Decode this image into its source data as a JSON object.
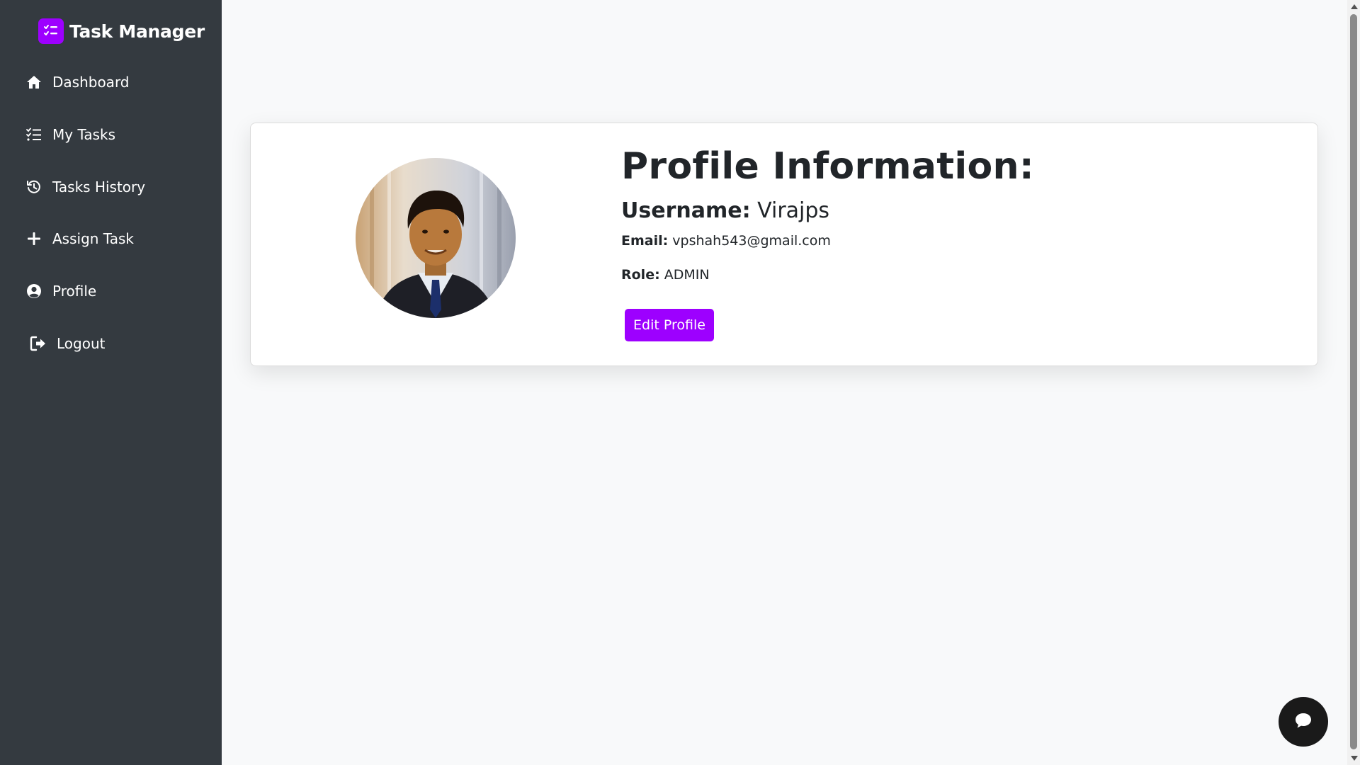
{
  "sidebar": {
    "brand": "Task Manager",
    "items": [
      {
        "label": "Dashboard",
        "icon": "home-icon"
      },
      {
        "label": "My Tasks",
        "icon": "list-check-icon"
      },
      {
        "label": "Tasks History",
        "icon": "history-icon"
      },
      {
        "label": "Assign Task",
        "icon": "plus-icon"
      },
      {
        "label": "Profile",
        "icon": "user-circle-icon"
      },
      {
        "label": "Logout",
        "icon": "logout-icon"
      }
    ]
  },
  "profile": {
    "heading": "Profile Information:",
    "username_label": "Username:",
    "username": "Virajps",
    "email_label": "Email:",
    "email": "vpshah543@gmail.com",
    "role_label": "Role:",
    "role": "ADMIN",
    "edit_button": "Edit Profile"
  },
  "colors": {
    "sidebar_bg": "#343a40",
    "accent": "#9d00ff",
    "page_bg": "#f8f9fa"
  }
}
